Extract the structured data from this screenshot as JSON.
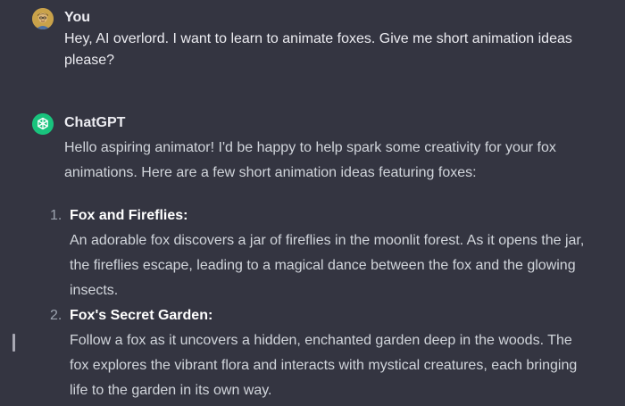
{
  "conversation": {
    "user": {
      "name": "You",
      "message": "Hey, AI overlord. I want to learn to animate foxes. Give me short animation ideas please?"
    },
    "assistant": {
      "name": "ChatGPT",
      "intro": "Hello aspiring animator! I'd be happy to help spark some creativity for your fox animations. Here are a few short animation ideas featuring foxes:",
      "ideas": [
        {
          "number": "1.",
          "title": "Fox and Fireflies:",
          "description": "An adorable fox discovers a jar of fireflies in the moonlit forest. As it opens the jar, the fireflies escape, leading to a magical dance between the fox and the glowing insects."
        },
        {
          "number": "2.",
          "title": "Fox's Secret Garden:",
          "description": "Follow a fox as it uncovers a hidden, enchanted garden deep in the woods. The fox explores the vibrant flora and interacts with mystical creatures, each bringing life to the garden in its own way."
        }
      ]
    }
  },
  "icons": {
    "user_avatar": "user-avatar-icon",
    "assistant_avatar": "openai-logo-icon"
  },
  "colors": {
    "background": "#343541",
    "assistant_accent": "#19c37d",
    "text_primary": "#ececf1",
    "text_secondary": "#d1d5db"
  }
}
